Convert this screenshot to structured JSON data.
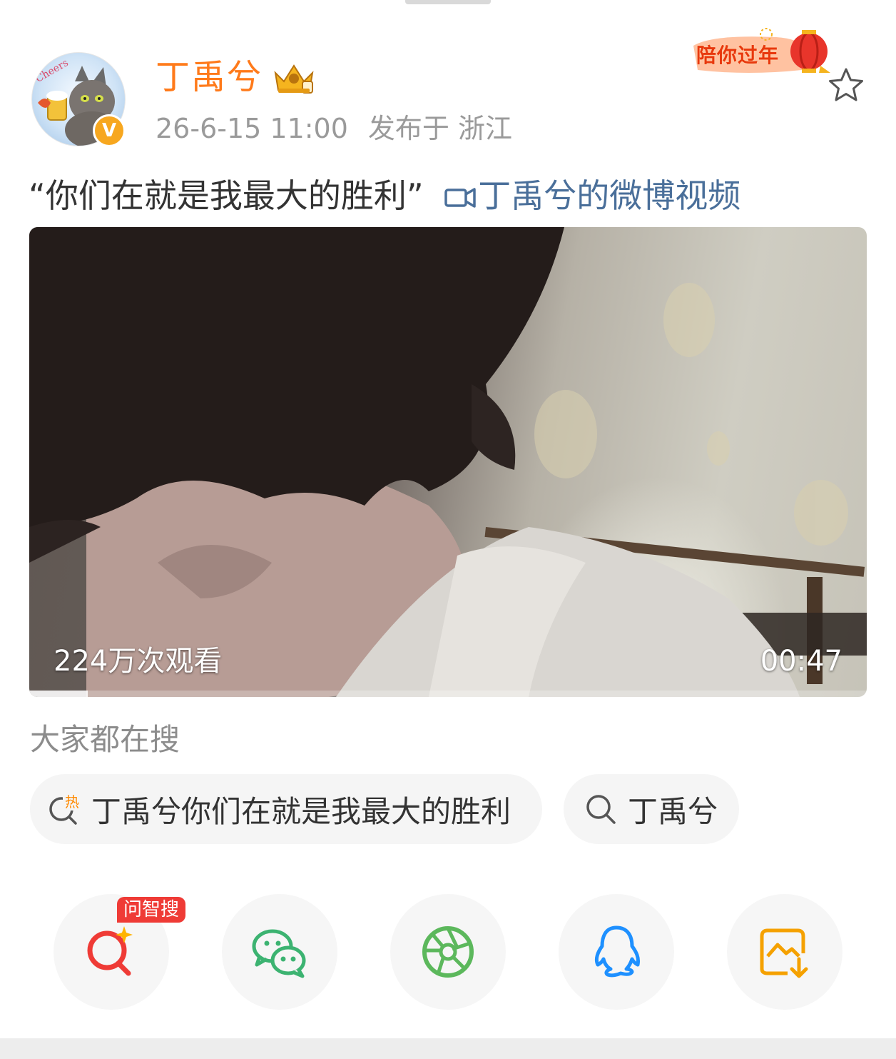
{
  "post": {
    "username": "丁禹兮",
    "date": "26-6-15 11:00",
    "location": "发布于 浙江",
    "verified_badge": "V",
    "festival_label": "陪你过年",
    "text_quote": "“你们在就是我最大的胜利”",
    "video_link": "丁禹兮的微博视频"
  },
  "video": {
    "views": "224万次观看",
    "duration": "00:47",
    "progress": 0.07
  },
  "search": {
    "title": "大家都在搜",
    "chips": [
      {
        "label": "丁禹兮你们在就是我最大的胜利",
        "icon": "hot-search-icon",
        "hot_label": "热"
      },
      {
        "label": "丁禹兮",
        "icon": "search-icon"
      }
    ]
  },
  "share": {
    "items": [
      {
        "name": "wenzhisou",
        "icon": "ai-search-icon",
        "color": "#ef3b36",
        "tag": "问智搜"
      },
      {
        "name": "wechat",
        "icon": "wechat-icon",
        "color": "#3cb371"
      },
      {
        "name": "moments",
        "icon": "moments-icon",
        "color": "#5cb85c"
      },
      {
        "name": "qq",
        "icon": "qq-icon",
        "color": "#1e90ff"
      },
      {
        "name": "save-image",
        "icon": "save-image-icon",
        "color": "#f5a100"
      }
    ]
  },
  "colors": {
    "username": "#ff7a1a",
    "link": "#4a6f9a",
    "meta": "#9a9a9a"
  }
}
